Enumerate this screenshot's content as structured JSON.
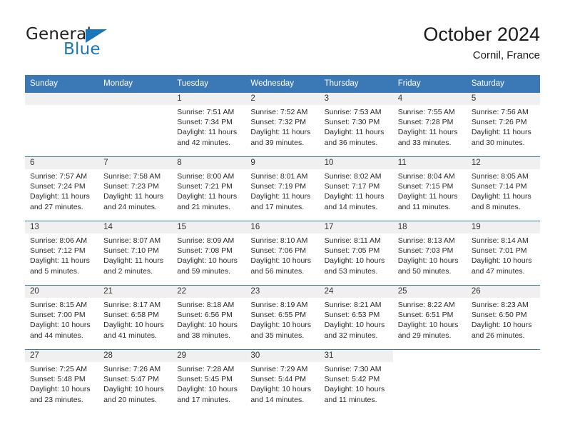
{
  "brand": {
    "name_part1": "General",
    "name_part2": "Blue",
    "logo_icon": "triangle-icon",
    "color_primary": "#1b75bb",
    "color_text": "#231f20"
  },
  "header": {
    "title": "October 2024",
    "subtitle": "Cornil, France"
  },
  "calendar": {
    "header_bg": "#3b78b6",
    "daynum_bg": "#f0f0f0",
    "weekdays": [
      "Sunday",
      "Monday",
      "Tuesday",
      "Wednesday",
      "Thursday",
      "Friday",
      "Saturday"
    ],
    "weeks": [
      [
        {
          "day": "",
          "sunrise": "",
          "sunset": "",
          "daylight_line1": "",
          "daylight_line2": "",
          "empty": true
        },
        {
          "day": "",
          "sunrise": "",
          "sunset": "",
          "daylight_line1": "",
          "daylight_line2": "",
          "empty": true
        },
        {
          "day": "1",
          "sunrise": "Sunrise: 7:51 AM",
          "sunset": "Sunset: 7:34 PM",
          "daylight_line1": "Daylight: 11 hours",
          "daylight_line2": "and 42 minutes."
        },
        {
          "day": "2",
          "sunrise": "Sunrise: 7:52 AM",
          "sunset": "Sunset: 7:32 PM",
          "daylight_line1": "Daylight: 11 hours",
          "daylight_line2": "and 39 minutes."
        },
        {
          "day": "3",
          "sunrise": "Sunrise: 7:53 AM",
          "sunset": "Sunset: 7:30 PM",
          "daylight_line1": "Daylight: 11 hours",
          "daylight_line2": "and 36 minutes."
        },
        {
          "day": "4",
          "sunrise": "Sunrise: 7:55 AM",
          "sunset": "Sunset: 7:28 PM",
          "daylight_line1": "Daylight: 11 hours",
          "daylight_line2": "and 33 minutes."
        },
        {
          "day": "5",
          "sunrise": "Sunrise: 7:56 AM",
          "sunset": "Sunset: 7:26 PM",
          "daylight_line1": "Daylight: 11 hours",
          "daylight_line2": "and 30 minutes."
        }
      ],
      [
        {
          "day": "6",
          "sunrise": "Sunrise: 7:57 AM",
          "sunset": "Sunset: 7:24 PM",
          "daylight_line1": "Daylight: 11 hours",
          "daylight_line2": "and 27 minutes."
        },
        {
          "day": "7",
          "sunrise": "Sunrise: 7:58 AM",
          "sunset": "Sunset: 7:23 PM",
          "daylight_line1": "Daylight: 11 hours",
          "daylight_line2": "and 24 minutes."
        },
        {
          "day": "8",
          "sunrise": "Sunrise: 8:00 AM",
          "sunset": "Sunset: 7:21 PM",
          "daylight_line1": "Daylight: 11 hours",
          "daylight_line2": "and 21 minutes."
        },
        {
          "day": "9",
          "sunrise": "Sunrise: 8:01 AM",
          "sunset": "Sunset: 7:19 PM",
          "daylight_line1": "Daylight: 11 hours",
          "daylight_line2": "and 17 minutes."
        },
        {
          "day": "10",
          "sunrise": "Sunrise: 8:02 AM",
          "sunset": "Sunset: 7:17 PM",
          "daylight_line1": "Daylight: 11 hours",
          "daylight_line2": "and 14 minutes."
        },
        {
          "day": "11",
          "sunrise": "Sunrise: 8:04 AM",
          "sunset": "Sunset: 7:15 PM",
          "daylight_line1": "Daylight: 11 hours",
          "daylight_line2": "and 11 minutes."
        },
        {
          "day": "12",
          "sunrise": "Sunrise: 8:05 AM",
          "sunset": "Sunset: 7:14 PM",
          "daylight_line1": "Daylight: 11 hours",
          "daylight_line2": "and 8 minutes."
        }
      ],
      [
        {
          "day": "13",
          "sunrise": "Sunrise: 8:06 AM",
          "sunset": "Sunset: 7:12 PM",
          "daylight_line1": "Daylight: 11 hours",
          "daylight_line2": "and 5 minutes."
        },
        {
          "day": "14",
          "sunrise": "Sunrise: 8:07 AM",
          "sunset": "Sunset: 7:10 PM",
          "daylight_line1": "Daylight: 11 hours",
          "daylight_line2": "and 2 minutes."
        },
        {
          "day": "15",
          "sunrise": "Sunrise: 8:09 AM",
          "sunset": "Sunset: 7:08 PM",
          "daylight_line1": "Daylight: 10 hours",
          "daylight_line2": "and 59 minutes."
        },
        {
          "day": "16",
          "sunrise": "Sunrise: 8:10 AM",
          "sunset": "Sunset: 7:06 PM",
          "daylight_line1": "Daylight: 10 hours",
          "daylight_line2": "and 56 minutes."
        },
        {
          "day": "17",
          "sunrise": "Sunrise: 8:11 AM",
          "sunset": "Sunset: 7:05 PM",
          "daylight_line1": "Daylight: 10 hours",
          "daylight_line2": "and 53 minutes."
        },
        {
          "day": "18",
          "sunrise": "Sunrise: 8:13 AM",
          "sunset": "Sunset: 7:03 PM",
          "daylight_line1": "Daylight: 10 hours",
          "daylight_line2": "and 50 minutes."
        },
        {
          "day": "19",
          "sunrise": "Sunrise: 8:14 AM",
          "sunset": "Sunset: 7:01 PM",
          "daylight_line1": "Daylight: 10 hours",
          "daylight_line2": "and 47 minutes."
        }
      ],
      [
        {
          "day": "20",
          "sunrise": "Sunrise: 8:15 AM",
          "sunset": "Sunset: 7:00 PM",
          "daylight_line1": "Daylight: 10 hours",
          "daylight_line2": "and 44 minutes."
        },
        {
          "day": "21",
          "sunrise": "Sunrise: 8:17 AM",
          "sunset": "Sunset: 6:58 PM",
          "daylight_line1": "Daylight: 10 hours",
          "daylight_line2": "and 41 minutes."
        },
        {
          "day": "22",
          "sunrise": "Sunrise: 8:18 AM",
          "sunset": "Sunset: 6:56 PM",
          "daylight_line1": "Daylight: 10 hours",
          "daylight_line2": "and 38 minutes."
        },
        {
          "day": "23",
          "sunrise": "Sunrise: 8:19 AM",
          "sunset": "Sunset: 6:55 PM",
          "daylight_line1": "Daylight: 10 hours",
          "daylight_line2": "and 35 minutes."
        },
        {
          "day": "24",
          "sunrise": "Sunrise: 8:21 AM",
          "sunset": "Sunset: 6:53 PM",
          "daylight_line1": "Daylight: 10 hours",
          "daylight_line2": "and 32 minutes."
        },
        {
          "day": "25",
          "sunrise": "Sunrise: 8:22 AM",
          "sunset": "Sunset: 6:51 PM",
          "daylight_line1": "Daylight: 10 hours",
          "daylight_line2": "and 29 minutes."
        },
        {
          "day": "26",
          "sunrise": "Sunrise: 8:23 AM",
          "sunset": "Sunset: 6:50 PM",
          "daylight_line1": "Daylight: 10 hours",
          "daylight_line2": "and 26 minutes."
        }
      ],
      [
        {
          "day": "27",
          "sunrise": "Sunrise: 7:25 AM",
          "sunset": "Sunset: 5:48 PM",
          "daylight_line1": "Daylight: 10 hours",
          "daylight_line2": "and 23 minutes."
        },
        {
          "day": "28",
          "sunrise": "Sunrise: 7:26 AM",
          "sunset": "Sunset: 5:47 PM",
          "daylight_line1": "Daylight: 10 hours",
          "daylight_line2": "and 20 minutes."
        },
        {
          "day": "29",
          "sunrise": "Sunrise: 7:28 AM",
          "sunset": "Sunset: 5:45 PM",
          "daylight_line1": "Daylight: 10 hours",
          "daylight_line2": "and 17 minutes."
        },
        {
          "day": "30",
          "sunrise": "Sunrise: 7:29 AM",
          "sunset": "Sunset: 5:44 PM",
          "daylight_line1": "Daylight: 10 hours",
          "daylight_line2": "and 14 minutes."
        },
        {
          "day": "31",
          "sunrise": "Sunrise: 7:30 AM",
          "sunset": "Sunset: 5:42 PM",
          "daylight_line1": "Daylight: 10 hours",
          "daylight_line2": "and 11 minutes."
        },
        {
          "day": "",
          "sunrise": "",
          "sunset": "",
          "daylight_line1": "",
          "daylight_line2": "",
          "blank": true
        },
        {
          "day": "",
          "sunrise": "",
          "sunset": "",
          "daylight_line1": "",
          "daylight_line2": "",
          "blank": true
        }
      ]
    ]
  }
}
